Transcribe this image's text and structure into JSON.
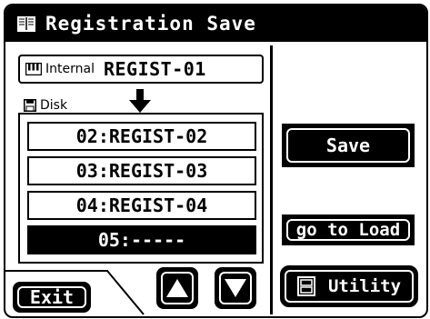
{
  "title_bar": {
    "title": "Registration Save",
    "icon": "book-icon"
  },
  "internal": {
    "label": "Internal",
    "value": "REGIST-01",
    "icon": "keyboard-icon"
  },
  "disk": {
    "label": "Disk",
    "icon": "floppy-disk-icon"
  },
  "list": {
    "items": [
      {
        "label": "02:REGIST-02",
        "selected": false
      },
      {
        "label": "03:REGIST-03",
        "selected": false
      },
      {
        "label": "04:REGIST-04",
        "selected": false
      },
      {
        "label": "05:-----",
        "selected": true
      }
    ]
  },
  "buttons": {
    "save": "Save",
    "go_to_load": "go to Load",
    "utility": "Utility",
    "exit": "Exit",
    "up_icon": "triangle-up-icon",
    "down_icon": "triangle-down-icon"
  },
  "colors": {
    "foreground": "#000000",
    "background": "#ffffff"
  }
}
